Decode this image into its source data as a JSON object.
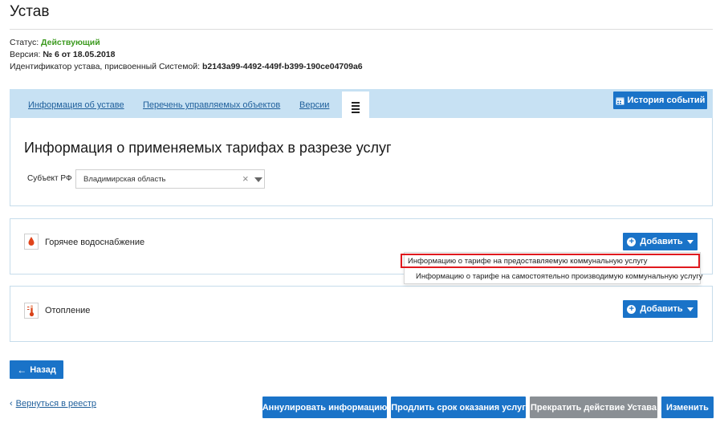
{
  "page": {
    "title": "Устав",
    "status_label": "Статус:",
    "status_value": "Действующий",
    "version_label": "Версия:",
    "version_value": "№ 6 от 18.05.2018",
    "identifier_label": "Идентификатор устава, присвоенный Системой:",
    "identifier_value": "b2143a99-4492-449f-b399-190ce04709a6"
  },
  "tabs": {
    "items": [
      {
        "label": "Информация об уставе"
      },
      {
        "label": "Перечень управляемых объектов"
      },
      {
        "label": "Версии"
      }
    ],
    "history_button": "История событий"
  },
  "tariffs": {
    "heading": "Информация о применяемых тарифах в разрезе услуг",
    "subject_label": "Субъект РФ",
    "subject_value": "Владимирская область",
    "clear_icon": "×"
  },
  "services": [
    {
      "label": "Горячее водоснабжение",
      "add_button": "Добавить",
      "icon": "water-drop-icon"
    },
    {
      "label": "Отопление",
      "add_button": "Добавить",
      "icon": "thermometer-icon"
    }
  ],
  "dropdown": {
    "items": [
      "Информацию о тарифе на предоставляемую коммунальную услугу",
      "Информацию о тарифе на самостоятельно производимую коммунальную услугу"
    ]
  },
  "footer": {
    "back_button": "Назад",
    "return_link": "Вернуться в реестр",
    "annul_button": "Аннулировать информацию",
    "extend_button": "Продлить срок оказания услуг",
    "terminate_button": "Прекратить действие Устава",
    "edit_button": "Изменить"
  },
  "colors": {
    "primary": "#1a73c8",
    "status_active": "#3c9a1f",
    "tab_bar": "#c7e1f3",
    "highlight": "#e0191e",
    "disabled": "#8a8f94"
  }
}
